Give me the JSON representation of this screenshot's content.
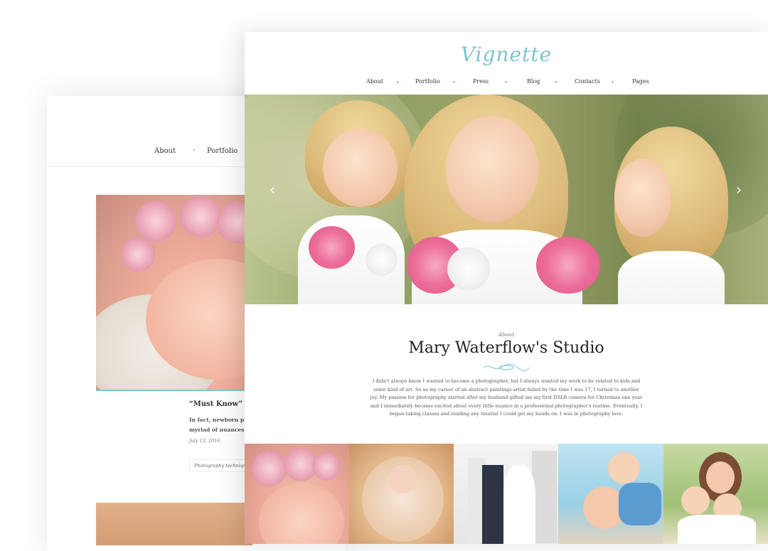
{
  "back_window": {
    "nav": [
      "About",
      "Portfolio"
    ],
    "post": {
      "title": "“Must Know” Newb",
      "excerpt_lines": [
        "In fact, newborn photo",
        "myriad of nuances it ha"
      ],
      "date": "July 13, 2016",
      "tag": "Photography techniques"
    }
  },
  "front_window": {
    "logo": "Vignette",
    "nav": [
      "About",
      "Portfolio",
      "Press",
      "Blog",
      "Contacts",
      "Pages"
    ],
    "hero": {
      "prev_icon": "chevron-left-icon",
      "next_icon": "chevron-right-icon"
    },
    "about": {
      "kicker": "About",
      "title": "Mary Waterflow's Studio",
      "body": "I didn't always know I wanted to become a photographer, but I always wanted my work to be related to kids and some kind of art. So as my career of an abstract paintings artist failed by the time I was 17, I turned to another joy. My passion for photography started after my husband gifted me my first DSLR camera for Christmas one year and I immediately became excited about every little nuance in a professional photographer's routine. Eventually, I began taking classes and reading any tutorial I could get my hands on. I was in photography love."
    }
  },
  "colors": {
    "accent": "#7fc4cf",
    "text": "#222222"
  }
}
